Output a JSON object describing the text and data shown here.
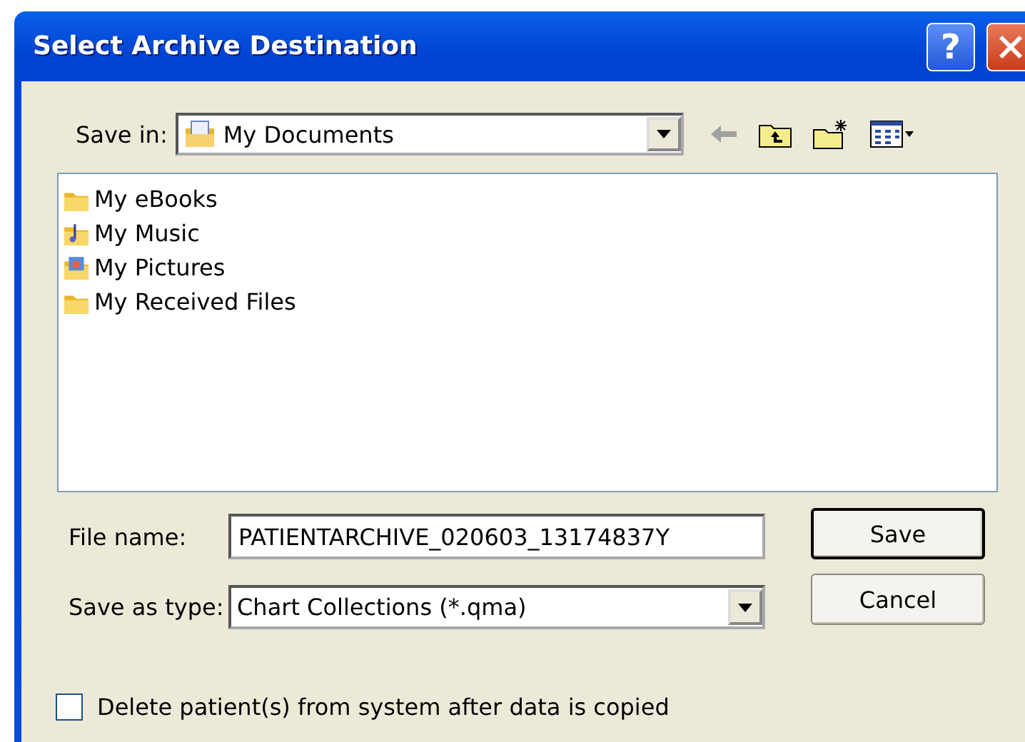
{
  "window": {
    "title": "Select Archive Destination",
    "buttons": [
      "?"
    ]
  },
  "save_in": {
    "label": "Save in:",
    "value": "My Documents"
  },
  "files": [
    {
      "name": "My eBooks",
      "kind": "folder",
      "selected": false
    },
    {
      "name": "My Music",
      "kind": "music",
      "selected": false
    },
    {
      "name": "My Pictures",
      "kind": "pictures",
      "selected": false
    },
    {
      "name": "My Received Files",
      "kind": "folder",
      "selected": false
    }
  ],
  "file_name": {
    "label": "File name:",
    "value": "PATIENTARCHIVE_020603_13174837Y"
  },
  "save_as_type": {
    "label": "Save as type:",
    "value": "Chart Collections (*.qma)"
  },
  "buttons": [
    {
      "label": "Save",
      "default": true
    },
    {
      "label": "Cancel",
      "default": false
    }
  ],
  "delete_option": {
    "label": "Delete patient(s) from system after data is copied",
    "checked": false
  }
}
